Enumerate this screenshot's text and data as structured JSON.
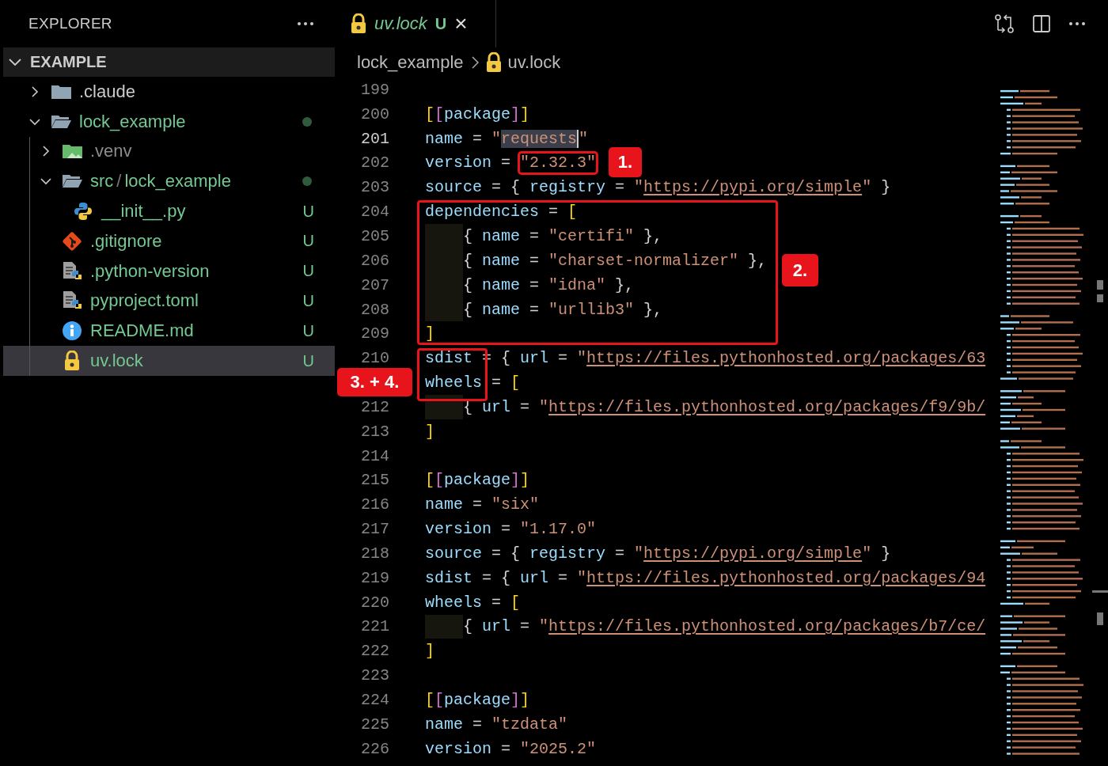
{
  "explorer": {
    "title": "EXPLORER",
    "workspace": {
      "label": "EXAMPLE",
      "expanded": true
    },
    "items": [
      {
        "label": ".claude",
        "kind": "folder",
        "expanded": false,
        "color": "#cccccc",
        "dot": false,
        "selected": false
      },
      {
        "label": "lock_example",
        "kind": "folder",
        "expanded": true,
        "color": "#73c991",
        "dot": true,
        "selected": false,
        "children": [
          {
            "label": ".venv",
            "kind": "venv",
            "expanded": false,
            "color": "#8c8c8c",
            "dot": false,
            "selected": false
          },
          {
            "parts": [
              "src",
              "/",
              "lock_example"
            ],
            "kind": "folder",
            "expanded": true,
            "color": "#73c991",
            "dot": true,
            "selected": false,
            "children": [
              {
                "label": "__init__.py",
                "kind": "python",
                "color": "#73c991",
                "status": "U",
                "selected": false
              }
            ]
          },
          {
            "label": ".gitignore",
            "kind": "git",
            "color": "#73c991",
            "status": "U",
            "selected": false
          },
          {
            "label": ".python-version",
            "kind": "python-file",
            "color": "#73c991",
            "status": "U",
            "selected": false
          },
          {
            "label": "pyproject.toml",
            "kind": "python-file",
            "color": "#73c991",
            "status": "U",
            "selected": false
          },
          {
            "label": "README.md",
            "kind": "info",
            "color": "#73c991",
            "status": "U",
            "selected": false
          },
          {
            "label": "uv.lock",
            "kind": "lock",
            "color": "#73c991",
            "status": "U",
            "selected": true
          }
        ]
      }
    ]
  },
  "editor": {
    "tab": {
      "label": "uv.lock",
      "status": "U",
      "preview": true,
      "close": "×"
    },
    "breadcrumbs": [
      {
        "label": "lock_example",
        "kind": "folder"
      },
      {
        "label": "uv.lock",
        "kind": "lock"
      }
    ],
    "lines": [
      {
        "number": "199",
        "active": false,
        "indent": false
      },
      {
        "number": "200",
        "active": false,
        "indent": false,
        "tokens": [
          {
            "kind": "brk1",
            "text": "["
          },
          {
            "kind": "brk2",
            "text": "["
          },
          {
            "kind": "key",
            "text": "package"
          },
          {
            "kind": "brk2",
            "text": "]"
          },
          {
            "kind": "brk1",
            "text": "]"
          }
        ]
      },
      {
        "number": "201",
        "active": true,
        "indent": false,
        "tokens": [
          {
            "kind": "key",
            "text": "name"
          },
          {
            "kind": "op",
            "text": " = "
          },
          {
            "kind": "str",
            "text": "\""
          },
          {
            "kind": "sel",
            "text": "requests"
          },
          {
            "kind": "str",
            "text": "\""
          }
        ]
      },
      {
        "number": "202",
        "active": false,
        "indent": false,
        "tokens": [
          {
            "kind": "key",
            "text": "version"
          },
          {
            "kind": "op",
            "text": " = "
          },
          {
            "kind": "str",
            "text": "\"2.32.3\""
          }
        ]
      },
      {
        "number": "203",
        "active": false,
        "indent": false,
        "tokens": [
          {
            "kind": "key",
            "text": "source"
          },
          {
            "kind": "op",
            "text": " = { "
          },
          {
            "kind": "key",
            "text": "registry"
          },
          {
            "kind": "op",
            "text": " = "
          },
          {
            "kind": "str",
            "text": "\""
          },
          {
            "kind": "url",
            "text": "https://pypi.org/simple"
          },
          {
            "kind": "str",
            "text": "\""
          },
          {
            "kind": "op",
            "text": " }"
          }
        ]
      },
      {
        "number": "204",
        "active": false,
        "indent": false,
        "tokens": [
          {
            "kind": "key",
            "text": "dependencies"
          },
          {
            "kind": "op",
            "text": " = "
          },
          {
            "kind": "brk1",
            "text": "["
          }
        ]
      },
      {
        "number": "205",
        "active": false,
        "indent": true,
        "tokens": [
          {
            "kind": "op",
            "text": "{ "
          },
          {
            "kind": "key",
            "text": "name"
          },
          {
            "kind": "op",
            "text": " = "
          },
          {
            "kind": "str",
            "text": "\"certifi\""
          },
          {
            "kind": "op",
            "text": " },"
          }
        ]
      },
      {
        "number": "206",
        "active": false,
        "indent": true,
        "tokens": [
          {
            "kind": "op",
            "text": "{ "
          },
          {
            "kind": "key",
            "text": "name"
          },
          {
            "kind": "op",
            "text": " = "
          },
          {
            "kind": "str",
            "text": "\"charset-normalizer\""
          },
          {
            "kind": "op",
            "text": " },"
          }
        ]
      },
      {
        "number": "207",
        "active": false,
        "indent": true,
        "tokens": [
          {
            "kind": "op",
            "text": "{ "
          },
          {
            "kind": "key",
            "text": "name"
          },
          {
            "kind": "op",
            "text": " = "
          },
          {
            "kind": "str",
            "text": "\"idna\""
          },
          {
            "kind": "op",
            "text": " },"
          }
        ]
      },
      {
        "number": "208",
        "active": false,
        "indent": true,
        "tokens": [
          {
            "kind": "op",
            "text": "{ "
          },
          {
            "kind": "key",
            "text": "name"
          },
          {
            "kind": "op",
            "text": " = "
          },
          {
            "kind": "str",
            "text": "\"urllib3\""
          },
          {
            "kind": "op",
            "text": " },"
          }
        ]
      },
      {
        "number": "209",
        "active": false,
        "indent": false,
        "tokens": [
          {
            "kind": "brk1",
            "text": "]"
          }
        ]
      },
      {
        "number": "210",
        "active": false,
        "indent": false,
        "tokens": [
          {
            "kind": "key",
            "text": "sdist"
          },
          {
            "kind": "op",
            "text": " = { "
          },
          {
            "kind": "key",
            "text": "url"
          },
          {
            "kind": "op",
            "text": " = "
          },
          {
            "kind": "str",
            "text": "\""
          },
          {
            "kind": "url",
            "text": "https://files.pythonhosted.org/packages/63"
          }
        ]
      },
      {
        "indent": false,
        "tokens": [
          {
            "kind": "key",
            "text": "wheels"
          },
          {
            "kind": "op",
            "text": " = "
          },
          {
            "kind": "brk1",
            "text": "["
          }
        ]
      },
      {
        "number": "212",
        "active": false,
        "indent": true,
        "tokens": [
          {
            "kind": "op",
            "text": "{ "
          },
          {
            "kind": "key",
            "text": "url"
          },
          {
            "kind": "op",
            "text": " = "
          },
          {
            "kind": "str",
            "text": "\""
          },
          {
            "kind": "url",
            "text": "https://files.pythonhosted.org/packages/f9/9b/"
          }
        ]
      },
      {
        "number": "213",
        "active": false,
        "indent": false,
        "tokens": [
          {
            "kind": "brk1",
            "text": "]"
          }
        ]
      },
      {
        "number": "214",
        "active": false,
        "indent": false
      },
      {
        "number": "215",
        "active": false,
        "indent": false,
        "tokens": [
          {
            "kind": "brk1",
            "text": "["
          },
          {
            "kind": "brk2",
            "text": "["
          },
          {
            "kind": "key",
            "text": "package"
          },
          {
            "kind": "brk2",
            "text": "]"
          },
          {
            "kind": "brk1",
            "text": "]"
          }
        ]
      },
      {
        "number": "216",
        "active": false,
        "indent": false,
        "tokens": [
          {
            "kind": "key",
            "text": "name"
          },
          {
            "kind": "op",
            "text": " = "
          },
          {
            "kind": "str",
            "text": "\"six\""
          }
        ]
      },
      {
        "number": "217",
        "active": false,
        "indent": false,
        "tokens": [
          {
            "kind": "key",
            "text": "version"
          },
          {
            "kind": "op",
            "text": " = "
          },
          {
            "kind": "str",
            "text": "\"1.17.0\""
          }
        ]
      },
      {
        "number": "218",
        "active": false,
        "indent": false,
        "tokens": [
          {
            "kind": "key",
            "text": "source"
          },
          {
            "kind": "op",
            "text": " = { "
          },
          {
            "kind": "key",
            "text": "registry"
          },
          {
            "kind": "op",
            "text": " = "
          },
          {
            "kind": "str",
            "text": "\""
          },
          {
            "kind": "url",
            "text": "https://pypi.org/simple"
          },
          {
            "kind": "str",
            "text": "\""
          },
          {
            "kind": "op",
            "text": " }"
          }
        ]
      },
      {
        "number": "219",
        "active": false,
        "indent": false,
        "tokens": [
          {
            "kind": "key",
            "text": "sdist"
          },
          {
            "kind": "op",
            "text": " = { "
          },
          {
            "kind": "key",
            "text": "url"
          },
          {
            "kind": "op",
            "text": " = "
          },
          {
            "kind": "str",
            "text": "\""
          },
          {
            "kind": "url",
            "text": "https://files.pythonhosted.org/packages/94"
          }
        ]
      },
      {
        "number": "220",
        "active": false,
        "indent": false,
        "tokens": [
          {
            "kind": "key",
            "text": "wheels"
          },
          {
            "kind": "op",
            "text": " = "
          },
          {
            "kind": "brk1",
            "text": "["
          }
        ]
      },
      {
        "number": "221",
        "active": false,
        "indent": true,
        "tokens": [
          {
            "kind": "op",
            "text": "{ "
          },
          {
            "kind": "key",
            "text": "url"
          },
          {
            "kind": "op",
            "text": " = "
          },
          {
            "kind": "str",
            "text": "\""
          },
          {
            "kind": "url",
            "text": "https://files.pythonhosted.org/packages/b7/ce/"
          }
        ]
      },
      {
        "number": "222",
        "active": false,
        "indent": false,
        "tokens": [
          {
            "kind": "brk1",
            "text": "]"
          }
        ]
      },
      {
        "number": "223",
        "active": false,
        "indent": false
      },
      {
        "number": "224",
        "active": false,
        "indent": false,
        "tokens": [
          {
            "kind": "brk1",
            "text": "["
          },
          {
            "kind": "brk2",
            "text": "["
          },
          {
            "kind": "key",
            "text": "package"
          },
          {
            "kind": "brk2",
            "text": "]"
          },
          {
            "kind": "brk1",
            "text": "]"
          }
        ]
      },
      {
        "number": "225",
        "active": false,
        "indent": false,
        "tokens": [
          {
            "kind": "key",
            "text": "name"
          },
          {
            "kind": "op",
            "text": " = "
          },
          {
            "kind": "str",
            "text": "\"tzdata\""
          }
        ]
      },
      {
        "number": "226",
        "active": false,
        "indent": false,
        "tokens": [
          {
            "kind": "key",
            "text": "version"
          },
          {
            "kind": "op",
            "text": " = "
          },
          {
            "kind": "str",
            "text": "\"2025.2\""
          }
        ]
      }
    ],
    "annotations": [
      {
        "label": "1."
      },
      {
        "label": "2."
      },
      {
        "label": "3. + 4."
      }
    ]
  }
}
